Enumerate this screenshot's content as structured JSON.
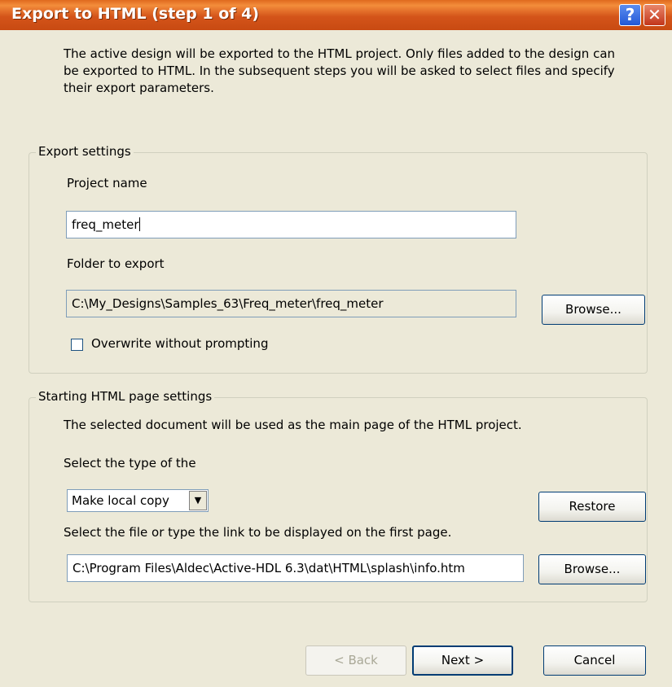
{
  "dialog": {
    "title": "Export to HTML (step 1 of 4)",
    "help_label": "?",
    "close_label": "✕"
  },
  "intro_text": "The active design will be exported to the HTML project. Only files added to the design can be exported to HTML. In the subsequent steps you will be asked to select files and specify their export parameters.",
  "export_settings": {
    "group_title": "Export settings",
    "project_name_label": "Project name",
    "project_name_value": "freq_meter",
    "folder_label": "Folder to export",
    "folder_value": "C:\\My_Designs\\Samples_63\\Freq_meter\\freq_meter",
    "browse_label": "Browse...",
    "overwrite_label": "Overwrite without prompting",
    "overwrite_checked": false
  },
  "starting_page": {
    "group_title": "Starting HTML page settings",
    "description": "The selected document will be used as the main page of the HTML project.",
    "type_label": "Select the type of the",
    "type_value": "Make local copy",
    "restore_label": "Restore",
    "file_label": "Select the file or type the link to be displayed on the first page.",
    "file_value": "C:\\Program Files\\Aldec\\Active-HDL 6.3\\dat\\HTML\\splash\\info.htm",
    "browse_label": "Browse..."
  },
  "footer": {
    "back_label": "< Back",
    "next_label": "Next >",
    "cancel_label": "Cancel"
  }
}
